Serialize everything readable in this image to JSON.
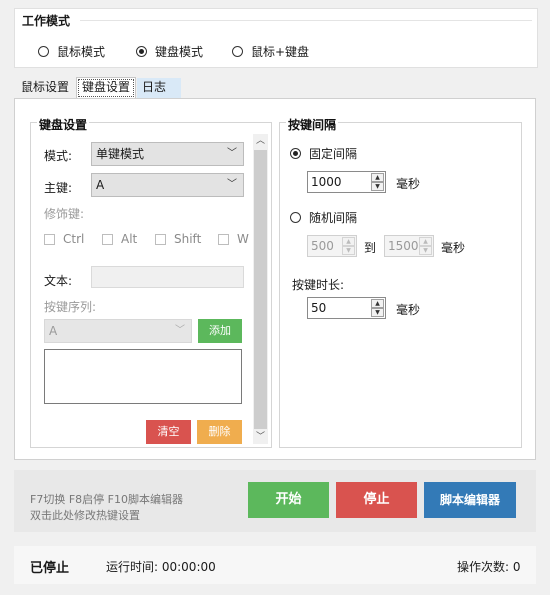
{
  "work_mode": {
    "title": "工作模式",
    "options": [
      {
        "label": "鼠标模式",
        "selected": false
      },
      {
        "label": "键盘模式",
        "selected": true
      },
      {
        "label": "鼠标+键盘",
        "selected": false
      }
    ]
  },
  "tabs": [
    {
      "label": "鼠标设置",
      "active": false
    },
    {
      "label": "键盘设置",
      "active": true
    },
    {
      "label": "日志",
      "active": false
    }
  ],
  "keyboard": {
    "group_title": "键盘设置",
    "mode_label": "模式:",
    "mode_value": "单键模式",
    "key_label": "主键:",
    "key_value": "A",
    "modifier_label": "修饰键:",
    "modifiers": [
      "Ctrl",
      "Alt",
      "Shift",
      "W"
    ],
    "text_label": "文本:",
    "text_value": "",
    "sequence_label": "按键序列:",
    "sequence_select": "A",
    "add_button": "添加",
    "clear_button": "清空",
    "delete_button": "删除"
  },
  "interval": {
    "group_title": "按键间隔",
    "fixed_label": "固定间隔",
    "fixed_value": "1000",
    "unit": "毫秒",
    "random_label": "随机间隔",
    "random_min": "500",
    "to_label": "到",
    "random_max": "1500",
    "duration_label": "按键时长:",
    "duration_value": "50"
  },
  "hotkeys": {
    "line1": "F7切换 F8启停 F10脚本编辑器",
    "line2": "双击此处修改热键设置"
  },
  "actions": {
    "start": "开始",
    "stop": "停止",
    "editor": "脚本编辑器"
  },
  "status": {
    "state": "已停止",
    "runtime": "运行时间: 00:00:00",
    "count": "操作次数: 0"
  },
  "colors": {
    "green": "#5cb85c",
    "red": "#d9534f",
    "blue": "#337ab7",
    "orange": "#f0ad4e",
    "log_tab": "#d9e9f7"
  }
}
